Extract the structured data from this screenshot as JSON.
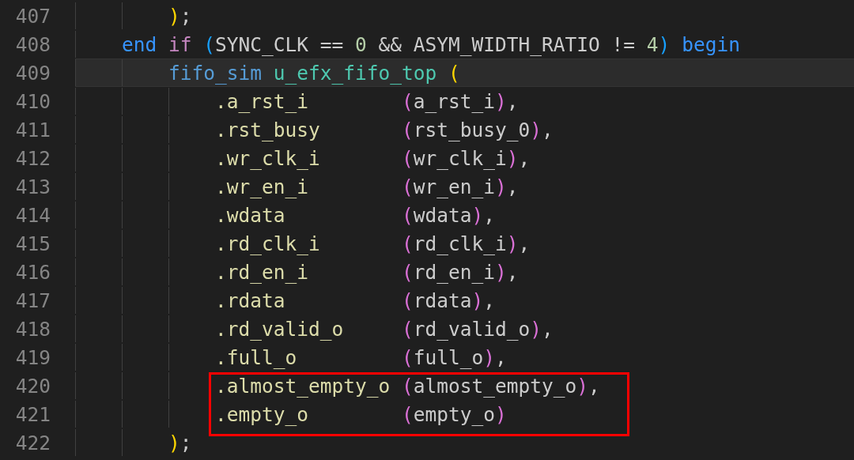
{
  "editor": {
    "lines": [
      {
        "number": "407",
        "current": false,
        "boxed": false,
        "tokens": [
          {
            "kind": "bracket1",
            "text": "        )"
          },
          {
            "kind": "plain",
            "text": ";"
          }
        ]
      },
      {
        "number": "408",
        "current": false,
        "boxed": false,
        "tokens": [
          {
            "kind": "keyword",
            "text": "    end"
          },
          {
            "kind": "control",
            "text": " if "
          },
          {
            "kind": "bracket3",
            "text": "("
          },
          {
            "kind": "plain",
            "text": "SYNC_CLK == "
          },
          {
            "kind": "number",
            "text": "0"
          },
          {
            "kind": "plain",
            "text": " && ASYM_WIDTH_RATIO != "
          },
          {
            "kind": "number",
            "text": "4"
          },
          {
            "kind": "bracket3",
            "text": ")"
          },
          {
            "kind": "keyword",
            "text": " begin"
          }
        ]
      },
      {
        "number": "409",
        "current": true,
        "boxed": false,
        "tokens": [
          {
            "kind": "type",
            "text": "        fifo_sim "
          },
          {
            "kind": "instance",
            "text": "u_efx_fifo_top "
          },
          {
            "kind": "bracket1",
            "text": "("
          }
        ]
      },
      {
        "number": "410",
        "current": false,
        "boxed": false,
        "tokens": [
          {
            "kind": "port",
            "text": "            .a_rst_i        "
          },
          {
            "kind": "bracket2",
            "text": "("
          },
          {
            "kind": "plain",
            "text": "a_rst_i"
          },
          {
            "kind": "bracket2",
            "text": ")"
          },
          {
            "kind": "plain",
            "text": ","
          }
        ]
      },
      {
        "number": "411",
        "current": false,
        "boxed": false,
        "tokens": [
          {
            "kind": "port",
            "text": "            .rst_busy       "
          },
          {
            "kind": "bracket2",
            "text": "("
          },
          {
            "kind": "plain",
            "text": "rst_busy_0"
          },
          {
            "kind": "bracket2",
            "text": ")"
          },
          {
            "kind": "plain",
            "text": ","
          }
        ]
      },
      {
        "number": "412",
        "current": false,
        "boxed": false,
        "tokens": [
          {
            "kind": "port",
            "text": "            .wr_clk_i       "
          },
          {
            "kind": "bracket2",
            "text": "("
          },
          {
            "kind": "plain",
            "text": "wr_clk_i"
          },
          {
            "kind": "bracket2",
            "text": ")"
          },
          {
            "kind": "plain",
            "text": ","
          }
        ]
      },
      {
        "number": "413",
        "current": false,
        "boxed": false,
        "tokens": [
          {
            "kind": "port",
            "text": "            .wr_en_i        "
          },
          {
            "kind": "bracket2",
            "text": "("
          },
          {
            "kind": "plain",
            "text": "wr_en_i"
          },
          {
            "kind": "bracket2",
            "text": ")"
          },
          {
            "kind": "plain",
            "text": ","
          }
        ]
      },
      {
        "number": "414",
        "current": false,
        "boxed": false,
        "tokens": [
          {
            "kind": "port",
            "text": "            .wdata          "
          },
          {
            "kind": "bracket2",
            "text": "("
          },
          {
            "kind": "plain",
            "text": "wdata"
          },
          {
            "kind": "bracket2",
            "text": ")"
          },
          {
            "kind": "plain",
            "text": ","
          }
        ]
      },
      {
        "number": "415",
        "current": false,
        "boxed": false,
        "tokens": [
          {
            "kind": "port",
            "text": "            .rd_clk_i       "
          },
          {
            "kind": "bracket2",
            "text": "("
          },
          {
            "kind": "plain",
            "text": "rd_clk_i"
          },
          {
            "kind": "bracket2",
            "text": ")"
          },
          {
            "kind": "plain",
            "text": ","
          }
        ]
      },
      {
        "number": "416",
        "current": false,
        "boxed": false,
        "tokens": [
          {
            "kind": "port",
            "text": "            .rd_en_i        "
          },
          {
            "kind": "bracket2",
            "text": "("
          },
          {
            "kind": "plain",
            "text": "rd_en_i"
          },
          {
            "kind": "bracket2",
            "text": ")"
          },
          {
            "kind": "plain",
            "text": ","
          }
        ]
      },
      {
        "number": "417",
        "current": false,
        "boxed": false,
        "tokens": [
          {
            "kind": "port",
            "text": "            .rdata          "
          },
          {
            "kind": "bracket2",
            "text": "("
          },
          {
            "kind": "plain",
            "text": "rdata"
          },
          {
            "kind": "bracket2",
            "text": ")"
          },
          {
            "kind": "plain",
            "text": ","
          }
        ]
      },
      {
        "number": "418",
        "current": false,
        "boxed": false,
        "tokens": [
          {
            "kind": "port",
            "text": "            .rd_valid_o     "
          },
          {
            "kind": "bracket2",
            "text": "("
          },
          {
            "kind": "plain",
            "text": "rd_valid_o"
          },
          {
            "kind": "bracket2",
            "text": ")"
          },
          {
            "kind": "plain",
            "text": ","
          }
        ]
      },
      {
        "number": "419",
        "current": false,
        "boxed": false,
        "tokens": [
          {
            "kind": "port",
            "text": "            .full_o         "
          },
          {
            "kind": "bracket2",
            "text": "("
          },
          {
            "kind": "plain",
            "text": "full_o"
          },
          {
            "kind": "bracket2",
            "text": ")"
          },
          {
            "kind": "plain",
            "text": ","
          }
        ]
      },
      {
        "number": "420",
        "current": false,
        "boxed": true,
        "tokens": [
          {
            "kind": "port",
            "text": "            .almost_empty_o "
          },
          {
            "kind": "bracket2",
            "text": "("
          },
          {
            "kind": "plain",
            "text": "almost_empty_o"
          },
          {
            "kind": "bracket2",
            "text": ")"
          },
          {
            "kind": "plain",
            "text": ","
          }
        ]
      },
      {
        "number": "421",
        "current": false,
        "boxed": true,
        "tokens": [
          {
            "kind": "port",
            "text": "            .empty_o        "
          },
          {
            "kind": "bracket2",
            "text": "("
          },
          {
            "kind": "plain",
            "text": "empty_o"
          },
          {
            "kind": "bracket2",
            "text": ")"
          }
        ]
      },
      {
        "number": "422",
        "current": false,
        "boxed": false,
        "tokens": [
          {
            "kind": "bracket1",
            "text": "        )"
          },
          {
            "kind": "plain",
            "text": ";"
          }
        ]
      }
    ]
  }
}
